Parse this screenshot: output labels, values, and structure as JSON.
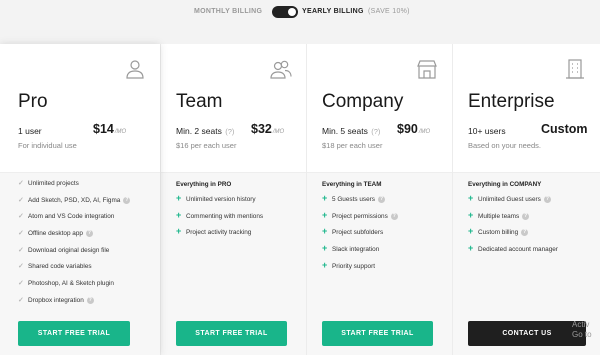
{
  "billing": {
    "monthly": "MONTHLY BILLING",
    "yearly": "YEARLY BILLING",
    "save": "(SAVE 10%)",
    "yearly_selected": true
  },
  "plans": {
    "pro": {
      "icon": "user-icon",
      "name": "Pro",
      "seats": "1 user",
      "price": "$14",
      "per": "/MO",
      "sub": "For individual use",
      "features": [
        {
          "text": "Unlimited projects",
          "info": false
        },
        {
          "text": "Add Sketch, PSD, XD, AI, Figma",
          "info": true
        },
        {
          "text": "Atom and VS Code integration",
          "info": false
        },
        {
          "text": "Offline desktop app",
          "info": true
        },
        {
          "text": "Download original design file",
          "info": false
        },
        {
          "text": "Shared code variables",
          "info": false
        },
        {
          "text": "Photoshop, AI & Sketch plugin",
          "info": false
        },
        {
          "text": "Dropbox integration",
          "info": true
        }
      ],
      "cta": "START FREE TRIAL"
    },
    "team": {
      "icon": "users-icon",
      "name": "Team",
      "seats": "Min. 2 seats",
      "q": "(?)",
      "price": "$32",
      "per": "/MO",
      "sub": "$16 per each user",
      "features_title": "Everything in PRO",
      "features": [
        {
          "text": "Unlimited version history"
        },
        {
          "text": "Commenting with mentions"
        },
        {
          "text": "Project activity tracking"
        }
      ],
      "cta": "START FREE TRIAL"
    },
    "company": {
      "icon": "store-icon",
      "name": "Company",
      "seats": "Min. 5 seats",
      "q": "(?)",
      "price": "$90",
      "per": "/MO",
      "sub": "$18 per each user",
      "features_title": "Everything in TEAM",
      "features": [
        {
          "text": "5 Guests users",
          "info": true
        },
        {
          "text": "Project permissions",
          "info": true
        },
        {
          "text": "Project subfolders",
          "info": false
        },
        {
          "text": "Slack integration",
          "info": false
        },
        {
          "text": "Priority support",
          "info": false
        }
      ],
      "cta": "START FREE TRIAL"
    },
    "enterprise": {
      "icon": "building-icon",
      "name": "Enterprise",
      "seats": "10+ users",
      "price": "Custom",
      "sub": "Based on your needs.",
      "features_title": "Everything in COMPANY",
      "features": [
        {
          "text": "Unlimited Guest users",
          "info": true
        },
        {
          "text": "Multiple teams",
          "info": true
        },
        {
          "text": "Custom billing",
          "info": true
        },
        {
          "text": "Dedicated account manager",
          "info": false
        }
      ],
      "cta": "CONTACT US"
    }
  },
  "watermark": {
    "line1": "Activ",
    "line2": "Go to"
  }
}
